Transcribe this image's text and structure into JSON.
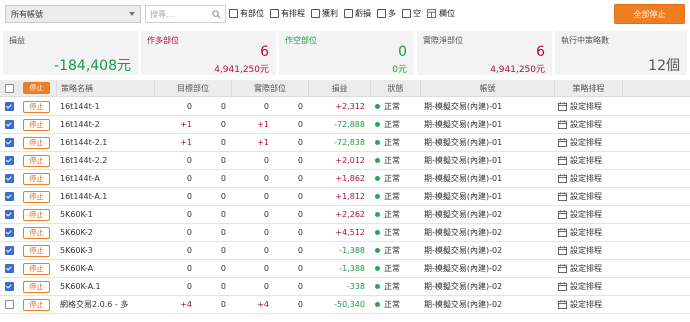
{
  "toolbar": {
    "account_select": "所有帳號",
    "search_placeholder": "搜尋...",
    "filters": [
      "有部位",
      "有排程",
      "獲利",
      "虧損",
      "多",
      "空"
    ],
    "columns_label": "欄位",
    "stop_all_label": "全部停止",
    "accent_color": "#ef7d22"
  },
  "summary": {
    "pnl": {
      "label": "損益",
      "value": "-184,408元"
    },
    "long": {
      "label": "作多部位",
      "count": "6",
      "amount": "4,941,250元"
    },
    "short": {
      "label": "作空部位",
      "count": "0",
      "amount": "0元"
    },
    "net": {
      "label": "實際淨部位",
      "count": "6",
      "amount": "4,941,250元"
    },
    "running": {
      "label": "執行中策略數",
      "value": "12個"
    }
  },
  "table": {
    "stop_label": "停止",
    "headers": {
      "name": "策略名稱",
      "target": "目標部位",
      "actual": "實際部位",
      "pnl": "損益",
      "status": "狀態",
      "account": "帳號",
      "schedule": "策略排程"
    },
    "rows": [
      {
        "checked": true,
        "name": "16t144t-1",
        "t1": "0",
        "t2": "0",
        "a1": "0",
        "a2": "0",
        "pnl": "+2,312",
        "status": "正常",
        "account": "期-模擬交易(內建)-01",
        "schedule": "設定排程"
      },
      {
        "checked": true,
        "name": "16t144t-2",
        "t1": "+1",
        "t2": "0",
        "a1": "+1",
        "a2": "0",
        "pnl": "-72,888",
        "status": "正常",
        "account": "期-模擬交易(內建)-01",
        "schedule": "設定排程"
      },
      {
        "checked": true,
        "name": "16t144t-2.1",
        "t1": "+1",
        "t2": "0",
        "a1": "+1",
        "a2": "0",
        "pnl": "-72,838",
        "status": "正常",
        "account": "期-模擬交易(內建)-01",
        "schedule": "設定排程"
      },
      {
        "checked": true,
        "name": "16t144t-2.2",
        "t1": "0",
        "t2": "0",
        "a1": "0",
        "a2": "0",
        "pnl": "+2,012",
        "status": "正常",
        "account": "期-模擬交易(內建)-01",
        "schedule": "設定排程"
      },
      {
        "checked": true,
        "name": "16t144t-A",
        "t1": "0",
        "t2": "0",
        "a1": "0",
        "a2": "0",
        "pnl": "+1,862",
        "status": "正常",
        "account": "期-模擬交易(內建)-01",
        "schedule": "設定排程"
      },
      {
        "checked": true,
        "name": "16t144t-A.1",
        "t1": "0",
        "t2": "0",
        "a1": "0",
        "a2": "0",
        "pnl": "+1,812",
        "status": "正常",
        "account": "期-模擬交易(內建)-01",
        "schedule": "設定排程"
      },
      {
        "checked": true,
        "name": "5K60K-1",
        "t1": "0",
        "t2": "0",
        "a1": "0",
        "a2": "0",
        "pnl": "+2,262",
        "status": "正常",
        "account": "期-模擬交易(內建)-02",
        "schedule": "設定排程"
      },
      {
        "checked": true,
        "name": "5K60K-2",
        "t1": "0",
        "t2": "0",
        "a1": "0",
        "a2": "0",
        "pnl": "+4,512",
        "status": "正常",
        "account": "期-模擬交易(內建)-02",
        "schedule": "設定排程"
      },
      {
        "checked": true,
        "name": "5K60K-3",
        "t1": "0",
        "t2": "0",
        "a1": "0",
        "a2": "0",
        "pnl": "-1,388",
        "status": "正常",
        "account": "期-模擬交易(內建)-02",
        "schedule": "設定排程"
      },
      {
        "checked": true,
        "name": "5K60K-A",
        "t1": "0",
        "t2": "0",
        "a1": "0",
        "a2": "0",
        "pnl": "-1,388",
        "status": "正常",
        "account": "期-模擬交易(內建)-02",
        "schedule": "設定排程"
      },
      {
        "checked": true,
        "name": "5K60K-A.1",
        "t1": "0",
        "t2": "0",
        "a1": "0",
        "a2": "0",
        "pnl": "-338",
        "status": "正常",
        "account": "期-模擬交易(內建)-02",
        "schedule": "設定排程"
      },
      {
        "checked": false,
        "name": "網格交易2.0.6 - 多",
        "t1": "+4",
        "t2": "0",
        "a1": "+4",
        "a2": "0",
        "pnl": "-50,340",
        "status": "正常",
        "account": "期-模擬交易(內建)-02",
        "schedule": "設定排程"
      }
    ]
  },
  "colors": {
    "positive": "#b00f3f",
    "negative": "#1b9c47",
    "status_ok": "#2ea44f"
  }
}
